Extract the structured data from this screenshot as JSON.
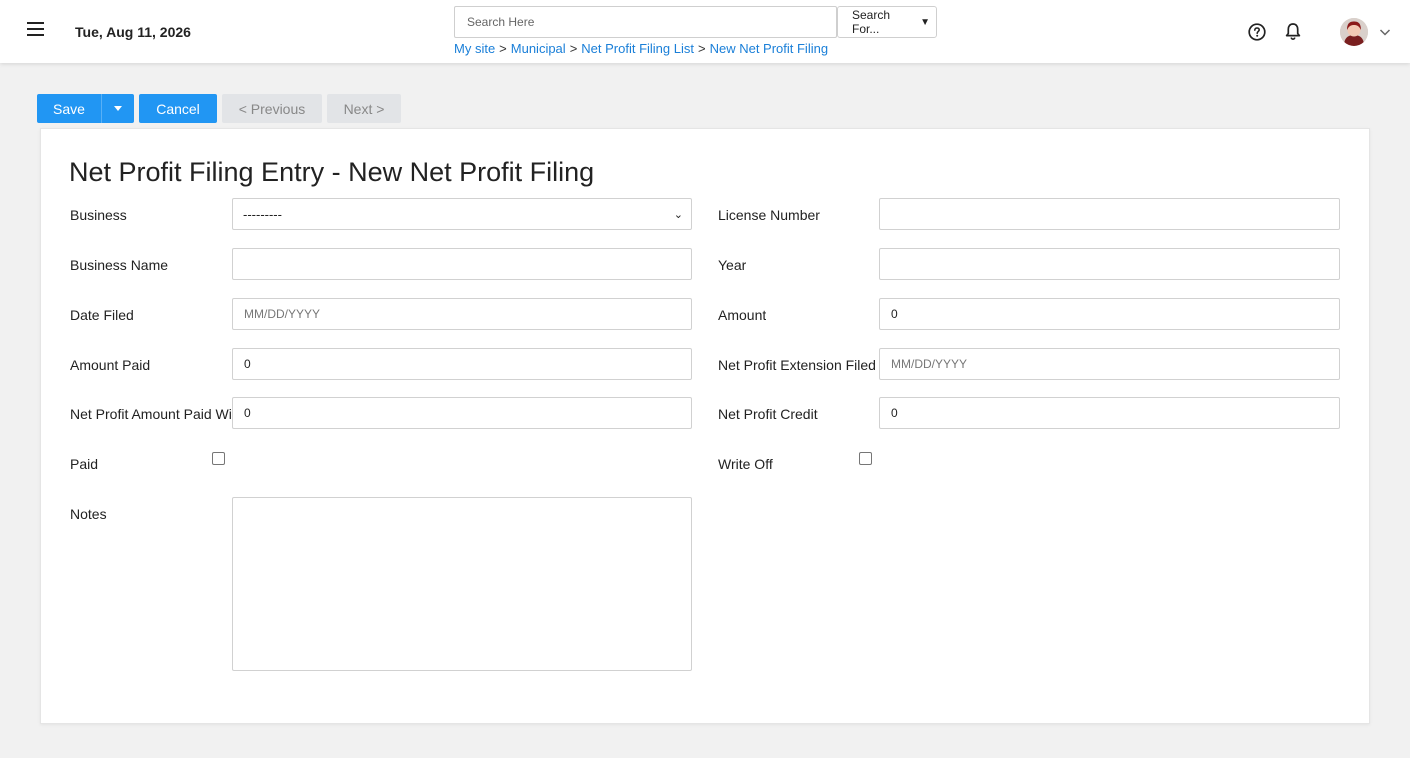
{
  "header": {
    "date": "Tue, Aug 11, 2026",
    "search_placeholder": "Search Here",
    "search_for_selected": "Search For...",
    "breadcrumb": [
      "My site",
      "Municipal",
      "Net Profit Filing List",
      "New Net Profit Filing"
    ],
    "breadcrumb_sep": ">"
  },
  "toolbar": {
    "save_label": "Save",
    "cancel_label": "Cancel",
    "previous_label": "< Previous",
    "next_label": "Next >"
  },
  "form": {
    "title": "Net Profit Filing Entry - New Net Profit Filing",
    "business": {
      "label": "Business",
      "value": "---------"
    },
    "license_number": {
      "label": "License Number",
      "value": ""
    },
    "business_name": {
      "label": "Business Name",
      "value": ""
    },
    "year": {
      "label": "Year",
      "value": ""
    },
    "date_filed": {
      "label": "Date Filed",
      "placeholder": "MM/DD/YYYY"
    },
    "amount": {
      "label": "Amount",
      "value": "0"
    },
    "amount_paid": {
      "label": "Amount Paid",
      "value": "0"
    },
    "extension_filed": {
      "label": "Net Profit Extension Filed",
      "placeholder": "MM/DD/YYYY"
    },
    "amount_paid_wi": {
      "label": "Net Profit Amount Paid Wi",
      "value": "0"
    },
    "credit": {
      "label": "Net Profit Credit",
      "value": "0"
    },
    "paid": {
      "label": "Paid",
      "checked": false
    },
    "write_off": {
      "label": "Write Off",
      "checked": false
    },
    "notes": {
      "label": "Notes",
      "value": ""
    }
  },
  "colors": {
    "primary": "#2196f3",
    "link": "#1a7fd8",
    "muted_button": "#e2e4e7"
  },
  "icons": [
    "hamburger-icon",
    "help-circle-icon",
    "bell-icon",
    "chevron-down-icon"
  ]
}
